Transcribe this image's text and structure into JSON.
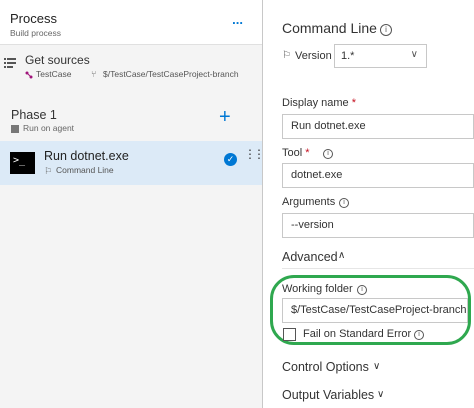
{
  "process": {
    "title": "Process",
    "subtitle": "Build process",
    "more": "..."
  },
  "get_sources": {
    "title": "Get sources",
    "repo": "TestCase",
    "branch": "$/TestCase/TestCaseProject-branch"
  },
  "phase": {
    "title": "Phase 1",
    "subtitle": "Run on agent",
    "add": "+"
  },
  "task": {
    "title": "Run dotnet.exe",
    "subtitle": "Command Line",
    "icon_text": ">_"
  },
  "detail": {
    "title": "Command Line",
    "version_label": "Version",
    "version_value": "1.*",
    "display_name_label": "Display name",
    "display_name_value": "Run dotnet.exe",
    "tool_label": "Tool",
    "tool_value": "dotnet.exe",
    "arguments_label": "Arguments",
    "arguments_value": "--version",
    "advanced_label": "Advanced",
    "working_folder_label": "Working folder",
    "working_folder_value": "$/TestCase/TestCaseProject-branch",
    "fail_stderr_label": "Fail on Standard Error",
    "control_options_label": "Control Options",
    "output_variables_label": "Output Variables",
    "required_mark": "*",
    "info_glyph": "i"
  },
  "colors": {
    "accent": "#0078d4",
    "selected_bg": "#dceaf7",
    "highlight": "#2fa84f"
  }
}
